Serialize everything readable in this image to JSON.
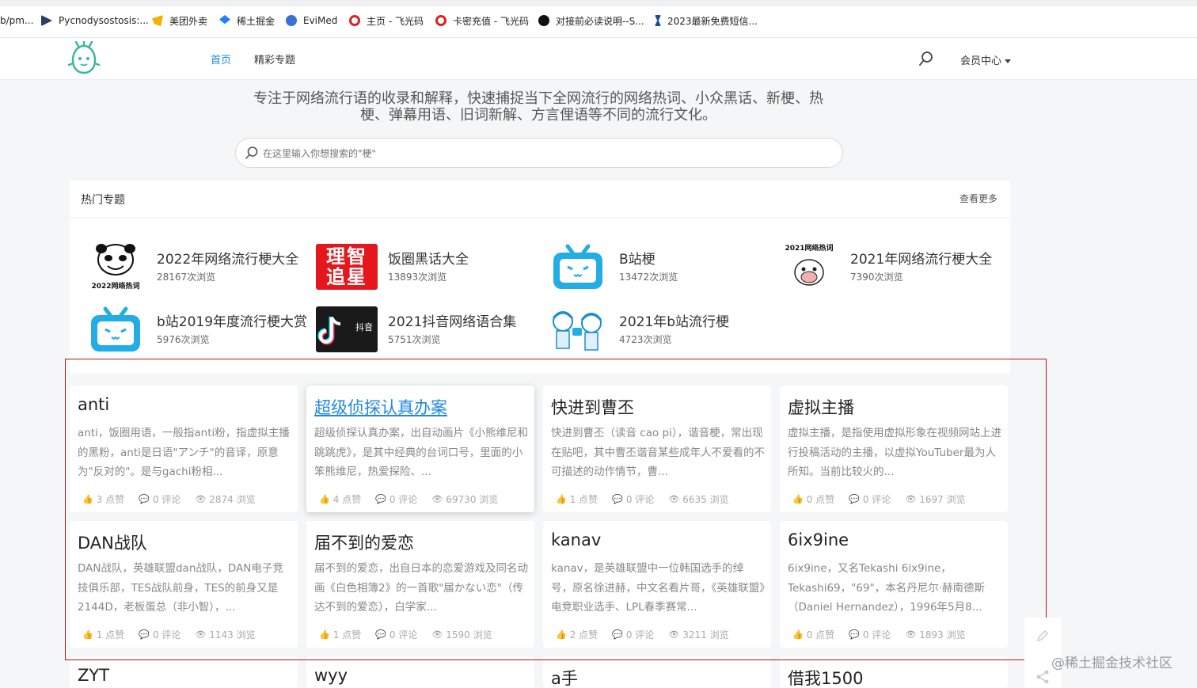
{
  "bookmarks": [
    {
      "label": "b/pm...",
      "color": "#888"
    },
    {
      "label": "Pycnodysostosis:...",
      "color": "#2b3d63"
    },
    {
      "label": "美团外卖",
      "color": "#f2b100"
    },
    {
      "label": "稀土掘金",
      "color": "#1e80ff"
    },
    {
      "label": "EviMed",
      "color": "#3b6fd6"
    },
    {
      "label": "主页 - 飞光码",
      "color": "#d22"
    },
    {
      "label": "卡密充值 - 飞光码",
      "color": "#d22"
    },
    {
      "label": "对接前必读说明--S...",
      "color": "#111"
    },
    {
      "label": "2023最新免费短信...",
      "color": "#1b4f9c"
    }
  ],
  "header": {
    "nav": [
      "首页",
      "精彩专题"
    ],
    "member_label": "会员中心"
  },
  "hero": {
    "tagline_line1": "专注于网络流行语的收录和解释，快速捕捉当下全网流行的网络热词、小众黑话、新梗、热",
    "tagline_line2": "梗、弹幕用语、旧词新解、方言俚语等不同的流行文化。",
    "search_placeholder": "在这里输入你想搜索的\"梗\""
  },
  "hot": {
    "title": "热门专题",
    "more": "查看更多",
    "topics": [
      {
        "name": "2022年网络流行梗大全",
        "views": "28167次浏览",
        "badge": "2022网络热词"
      },
      {
        "name": "饭圈黑话大全",
        "views": "13893次浏览",
        "badge": "理智追星"
      },
      {
        "name": "B站梗",
        "views": "13472次浏览"
      },
      {
        "name": "2021年网络流行梗大全",
        "views": "7390次浏览",
        "badge": "2021网络热词"
      },
      {
        "name": "b站2019年度流行梗大赏",
        "views": "5976次浏览"
      },
      {
        "name": "2021抖音网络语合集",
        "views": "5751次浏览",
        "badge": "抖音"
      },
      {
        "name": "2021年b站流行梗",
        "views": "4723次浏览"
      }
    ]
  },
  "cards": [
    {
      "title": "anti",
      "desc": "anti，饭圈用语，一般指anti粉，指虚拟主播的黑粉，anti是日语\"アンチ\"的音译，原意为\"反对的\"。是与gachi粉相...",
      "likes": "3 点赞",
      "comments": "0 评论",
      "views": "2874 浏览"
    },
    {
      "title": "超级侦探认真办案",
      "desc": "超级侦探认真办案，出自动画片《小熊维尼和跳跳虎》，是其中经典的台词口号，里面的小笨熊维尼，热爱探险、...",
      "likes": "4 点赞",
      "comments": "0 评论",
      "views": "69730 浏览"
    },
    {
      "title": "快进到曹丕",
      "desc": "快进到曹丕（读音 cao pi），谐音梗，常出现在贴吧，其中曹丕谐音某些成年人不爱看的不可描述的动作情节，曹...",
      "likes": "1 点赞",
      "comments": "0 评论",
      "views": "6635 浏览"
    },
    {
      "title": "虚拟主播",
      "desc": "虚拟主播，是指使用虚拟形象在视频网站上进行投稿活动的主播，以虚拟YouTuber最为人所知。当前比较火的...",
      "likes": "0 点赞",
      "comments": "0 评论",
      "views": "1697 浏览"
    },
    {
      "title": "DAN战队",
      "desc": "DAN战队，英雄联盟dan战队，DAN电子竞技俱乐部，TES战队前身，TES的前身又是2144D，老板蛋总（非小智），...",
      "likes": "1 点赞",
      "comments": "0 评论",
      "views": "1143 浏览"
    },
    {
      "title": "届不到的爱恋",
      "desc": "届不到的爱恋，出自日本的恋爱游戏及同名动画《白色相簿2》的一首歌\"届かない恋\"（传达不到的爱恋），白学家...",
      "likes": "1 点赞",
      "comments": "0 评论",
      "views": "1590 浏览"
    },
    {
      "title": "kanav",
      "desc": "kanav，是英雄联盟中一位韩国选手的绰号，原名徐进赫，中文名看片哥，《英雄联盟》电竞职业选手、LPL春季赛常...",
      "likes": "2 点赞",
      "comments": "0 评论",
      "views": "3211 浏览"
    },
    {
      "title": "6ix9ine",
      "desc": "6ix9ine，又名Tekashi 6ix9ine，Tekashi69，\"69\"，本名丹尼尔·赫南德斯（Daniel Hernandez），1996年5月8...",
      "likes": "0 点赞",
      "comments": "0 评论",
      "views": "1893 浏览"
    }
  ],
  "cards_partial": [
    "ZYT",
    "wyy",
    "a手",
    "借我1500"
  ],
  "watermark": "@稀土掘金技术社区",
  "colors": {
    "accent": "#1e88e5",
    "frame": "#b4151d",
    "bilibili": "#23ade5"
  }
}
